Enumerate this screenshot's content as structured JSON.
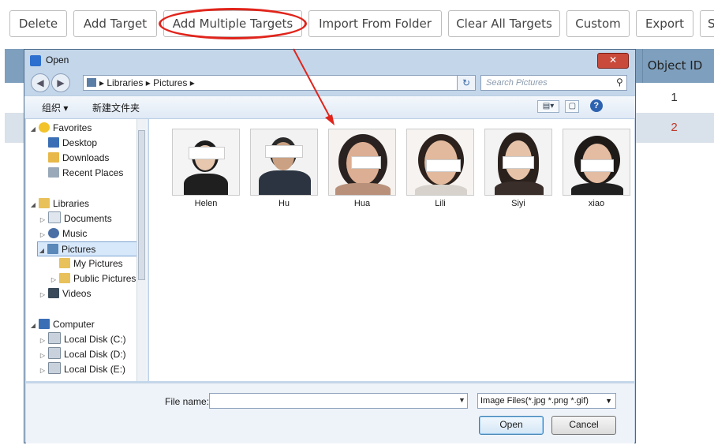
{
  "toolbar": {
    "delete": "Delete",
    "add_target": "Add Target",
    "add_multiple": "Add Multiple Targets",
    "import_folder": "Import From Folder",
    "clear_all": "Clear All Targets",
    "custom": "Custom",
    "export": "Export",
    "more": "S"
  },
  "table": {
    "object_id_header": "Object ID",
    "rows": [
      {
        "object_id": "1"
      },
      {
        "object_id": "2"
      }
    ]
  },
  "dialog": {
    "title": "Open",
    "close": "✕",
    "address": "▸ Libraries ▸ Pictures ▸",
    "search_placeholder": "Search Pictures",
    "organize": "组织 ▾",
    "new_folder": "新建文件夹",
    "nav": [
      {
        "label": "Favorites",
        "icon": "star-icon"
      },
      {
        "label": "Desktop",
        "icon": "desktop-icon"
      },
      {
        "label": "Downloads",
        "icon": "downloads-icon"
      },
      {
        "label": "Recent Places",
        "icon": "recent-places-icon"
      },
      {
        "label": "Libraries",
        "icon": "libraries-icon"
      },
      {
        "label": "Documents",
        "icon": "documents-icon"
      },
      {
        "label": "Music",
        "icon": "music-icon"
      },
      {
        "label": "Pictures",
        "icon": "pictures-icon"
      },
      {
        "label": "My Pictures",
        "icon": "folder-icon"
      },
      {
        "label": "Public Pictures",
        "icon": "folder-icon"
      },
      {
        "label": "Videos",
        "icon": "videos-icon"
      },
      {
        "label": "Computer",
        "icon": "computer-icon"
      },
      {
        "label": "Local Disk (C:)",
        "icon": "disk-icon"
      },
      {
        "label": "Local Disk (D:)",
        "icon": "disk-icon"
      },
      {
        "label": "Local Disk (E:)",
        "icon": "disk-icon"
      }
    ],
    "files": [
      "Helen",
      "Hu",
      "Hua",
      "Lili",
      "Siyi",
      "xiao"
    ],
    "file_name_label": "File name:",
    "file_name_value": "",
    "filter": "Image Files(*.jpg *.png *.gif)",
    "open": "Open",
    "cancel": "Cancel"
  },
  "colors": {
    "annotation": "#e0241b",
    "table_header": "#7e9fbd",
    "row_highlight_text": "#c0392b"
  }
}
